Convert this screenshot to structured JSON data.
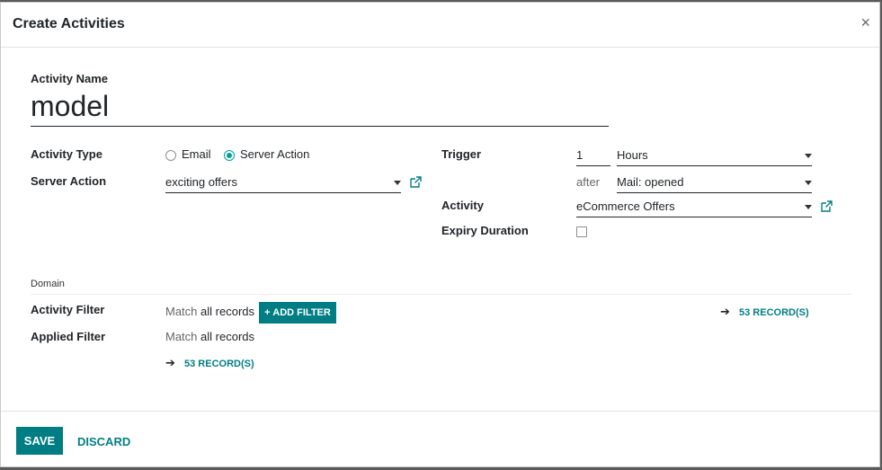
{
  "dialog": {
    "title": "Create Activities",
    "close_glyph": "×"
  },
  "form": {
    "activity_name_label": "Activity Name",
    "activity_name_value": "model",
    "activity_type_label": "Activity Type",
    "activity_type_options": [
      "Email",
      "Server Action"
    ],
    "activity_type_selected": "Server Action",
    "server_action_label": "Server Action",
    "server_action_value": "exciting offers",
    "trigger_label": "Trigger",
    "trigger_value": "1",
    "trigger_unit": "Hours",
    "after_label": "after",
    "after_value": "Mail: opened",
    "activity_label": "Activity",
    "activity_value": "eCommerce Offers",
    "expiry_duration_label": "Expiry Duration",
    "expiry_duration_checked": false
  },
  "domain": {
    "section_label": "Domain",
    "activity_filter_label": "Activity Filter",
    "activity_filter_match_prefix": "Match",
    "activity_filter_match_emphasis": "all records",
    "add_filter_label": "ADD FILTER",
    "add_filter_icon": "+",
    "activity_filter_records": "53 RECORD(S)",
    "applied_filter_label": "Applied Filter",
    "applied_filter_match_prefix": "Match",
    "applied_filter_match_emphasis": "all records",
    "applied_filter_records": "53 RECORD(S)"
  },
  "footer": {
    "save_label": "SAVE",
    "discard_label": "DISCARD"
  },
  "colors": {
    "primary": "#017e84",
    "radio_accent": "#00A09D"
  }
}
